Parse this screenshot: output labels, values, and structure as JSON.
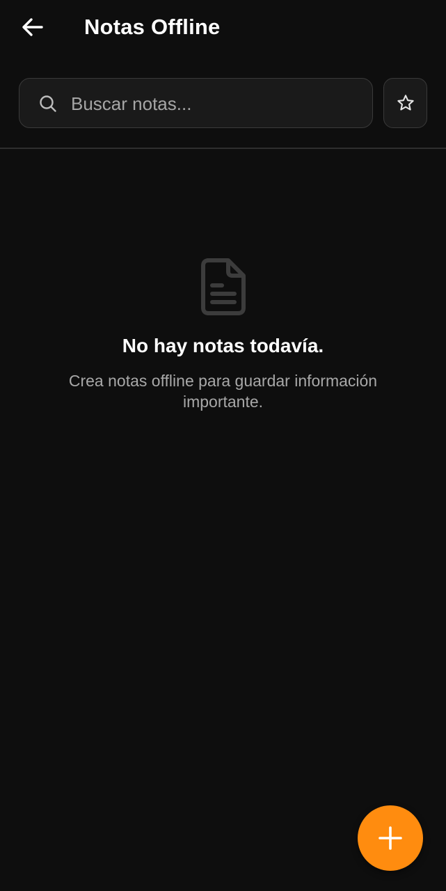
{
  "header": {
    "title": "Notas Offline",
    "back_icon": "arrow-left-icon"
  },
  "search": {
    "placeholder": "Buscar notas...",
    "value": "",
    "icon": "search-icon"
  },
  "favorites_button": {
    "icon": "star-outline-icon"
  },
  "empty_state": {
    "icon": "document-icon",
    "title": "No hay notas todavía.",
    "subtitle": "Crea notas offline para guardar información importante."
  },
  "fab": {
    "icon": "plus-icon",
    "color": "#ff8c0f"
  },
  "colors": {
    "background": "#0e0e0e",
    "accent": "#ff8c0f",
    "muted_text": "#a8a8a8"
  }
}
